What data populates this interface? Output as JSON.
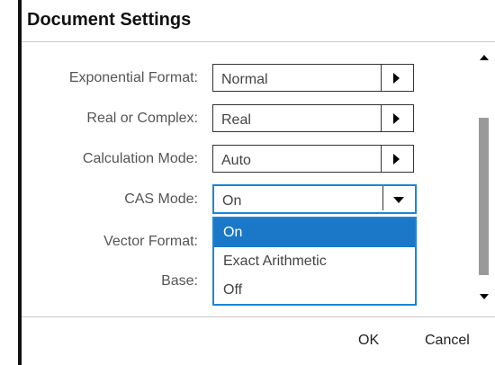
{
  "dialog": {
    "title": "Document Settings",
    "ok_label": "OK",
    "cancel_label": "Cancel"
  },
  "settings": [
    {
      "label": "Exponential Format:",
      "value": "Normal"
    },
    {
      "label": "Real or Complex:",
      "value": "Real"
    },
    {
      "label": "Calculation Mode:",
      "value": "Auto"
    },
    {
      "label": "CAS Mode:",
      "value": "On"
    },
    {
      "label": "Vector Format:"
    },
    {
      "label": "Base:"
    }
  ],
  "dropdown": {
    "options": [
      "On",
      "Exact Arithmetic",
      "Off"
    ],
    "selected": "On"
  },
  "colors": {
    "accent": "#1b86d6",
    "selected_bg": "#1b78c8"
  }
}
